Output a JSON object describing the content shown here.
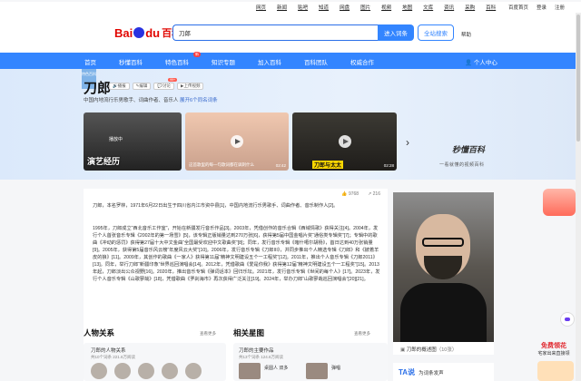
{
  "topnav": {
    "links": [
      "网页",
      "新闻",
      "贴吧",
      "知道",
      "网盘",
      "图片",
      "视频",
      "地图",
      "文库",
      "资讯",
      "采购",
      "百科"
    ],
    "right": [
      "百度首页",
      "登录",
      "注册"
    ]
  },
  "search": {
    "logo_bai": "Bai",
    "logo_du": "du",
    "logo_baike": "百科",
    "query": "刀郎",
    "enter_label": "进入词条",
    "all_label": "全站搜索",
    "help_label": "帮助"
  },
  "nav": {
    "items": [
      "首页",
      "秒懂百科",
      "特色百科",
      "知识专题",
      "加入百科",
      "百科团队",
      "权威合作"
    ],
    "badge": "新",
    "user_label": "个人中心"
  },
  "entry": {
    "tag": "特色百科",
    "title": "刀郎",
    "actions": [
      "播报",
      "编辑",
      "讨论",
      "上传视频"
    ],
    "discuss_badge": "99+",
    "subtitle": "中国内地流行乐男歌手、词曲作者、音乐人",
    "expand": "展开6个同名词条"
  },
  "cards": {
    "c1_caption": "演艺经历",
    "c1_playing": "播放中",
    "c2_desc": "这首歌里的每一句歌词都在讽刺什么",
    "c2_time": "02:42",
    "c3_tag": "刀郎与太太",
    "c3_time": "02:28"
  },
  "brand": {
    "name": "秒懂百科",
    "slogan": "一看就懂的视频百科"
  },
  "stats": {
    "likes": "9768",
    "shares": "216"
  },
  "content": {
    "p1": "刀郎，本名罗林，1971年6月22日出生于四川省内江市资中县[1]，中国内地流行乐男歌手、词曲作者、音乐制作人[2]。",
    "p2": "1995年，刀郎成立“西北音乐工作室”，开始在新疆发行音乐作品[3]。2003年，凭借创作的音乐合辑《西域情歌》获得关注[4]。2004年，发行个人首张音乐专辑《2002年的第一场雪》[5]，该专辑正版销量达到270万张[6]，获得第5届中国金唱片奖“通俗类专辑奖”[7]；专辑中的歌曲《冲动的惩罚》获得第27届十大中文金曲“全国最受欢迎中文歌曲奖”[8]；同年，发行音乐专辑《喀什噶尔胡杨》，首日达到40万张销量[9]。2005年，获得第5届音乐风云榜“年度风云大奖”[10]。2006年，发行音乐专辑《刀郎III》，并同步推出个人精选专辑《刀郎》和《披着羊皮的狼》[11]。2009年，其创作的歌曲《一家人》获得第11届“精神文明建设五个一工程奖”[12]。2011年，推出个人音乐专辑《刀郎2011》[13]。同年，举行刀郎“新疆印象”世界巡回演唱会[14]。2012年，凭借歌曲《爱是你我》获得第12届“精神文明建设五个一工程奖”[15]。2013年起，刀郎淡出公众视野[16]。2020年，推出音乐专辑《弹词话本》回归乐坛。2021年，发行音乐专辑《世间的每个人》[17]。2023年，发行个人音乐专辑《山歌寥哉》[18]，凭借歌曲《罗刹海市》再次获得广泛关注[19]。2024年，举办刀郎“山歌寥哉巡回演唱会”[20][21]。"
  },
  "sections": {
    "relations": "人物关系",
    "star_map": "相关星图",
    "relations_more": "查看更多",
    "star_more": "查看更多",
    "rel_box_title": "刀郎的人物关系",
    "rel_box_meta": "共10个词条   221.6万阅读",
    "star_box_title": "刀郎的主要作品",
    "star_box_meta": "共13个词条   124.6万阅读",
    "work1": "桌圆人 双多",
    "work2": "弹唱"
  },
  "photo": {
    "caption": "刀郎的概述图",
    "count": "（10张）"
  },
  "ad": {
    "brand": "TA说",
    "text": "为词条发声"
  },
  "promo": {
    "title": "免费领花",
    "sub": "宅家出来直接领"
  },
  "colors": {
    "accent": "#3385ff",
    "logo_red": "#e10601"
  }
}
